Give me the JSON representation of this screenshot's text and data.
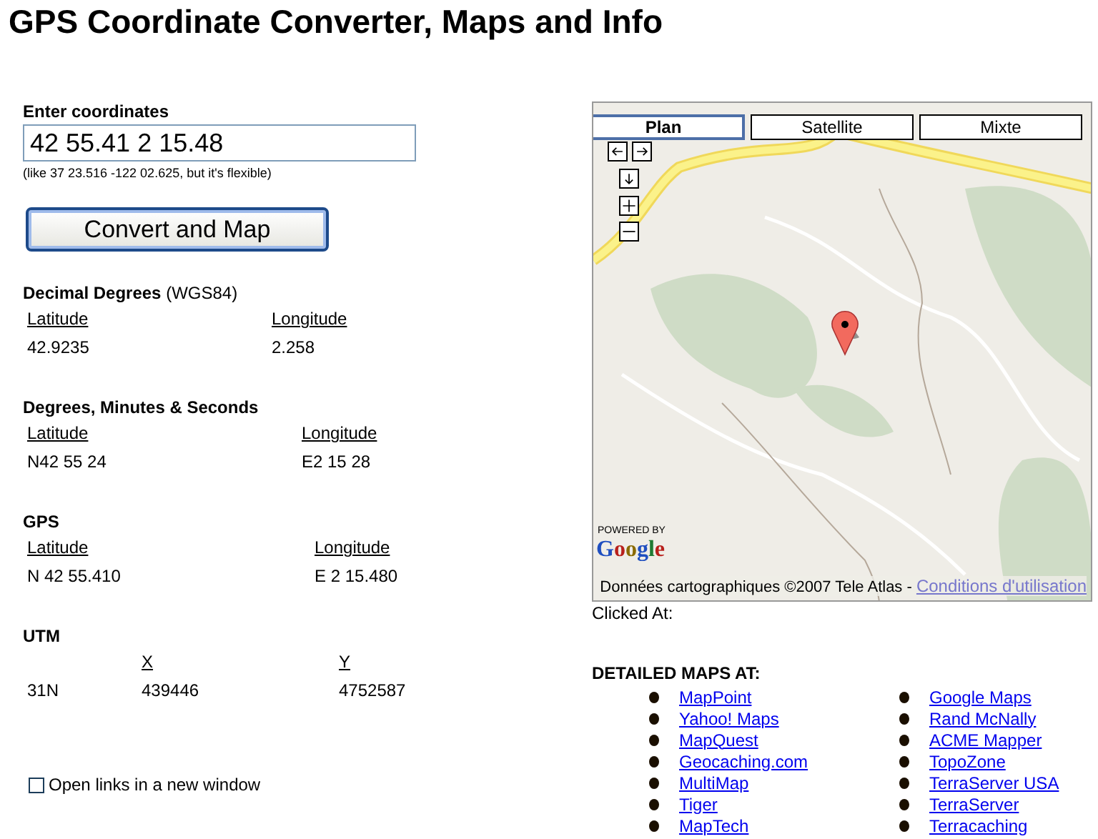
{
  "page_title": "GPS Coordinate Converter, Maps and Info",
  "input": {
    "label": "Enter coordinates",
    "value": "42 55.41 2 15.48",
    "hint": "(like 37 23.516 -122 02.625, but it's flexible)"
  },
  "convert_button": "Convert and Map",
  "sections": [
    {
      "title": "Decimal Degrees",
      "note": "(WGS84)",
      "columns": [
        {
          "header": "Latitude",
          "value": "42.9235"
        },
        {
          "header": "Longitude",
          "value": "2.258"
        }
      ]
    },
    {
      "title": "Degrees, Minutes & Seconds",
      "columns": [
        {
          "header": "Latitude",
          "value": "N42 55 24"
        },
        {
          "header": "Longitude",
          "value": "E2 15 28"
        }
      ]
    },
    {
      "title": "GPS",
      "columns": [
        {
          "header": "Latitude",
          "value": "N 42 55.410"
        },
        {
          "header": "Longitude",
          "value": "E 2 15.480"
        }
      ]
    },
    {
      "title": "UTM",
      "columns": [
        {
          "value": "31N"
        },
        {
          "header": "X",
          "value": "439446"
        },
        {
          "header": "Y",
          "value": "4752587"
        }
      ]
    }
  ],
  "new_window_option": {
    "label": "Open links in a new window",
    "checked": false
  },
  "map": {
    "tabs": [
      {
        "label": "Plan",
        "selected": true
      },
      {
        "label": "Satellite",
        "selected": false
      },
      {
        "label": "Mixte",
        "selected": false
      }
    ],
    "powered_by": "POWERED BY",
    "logo": "Google",
    "attribution": "Données cartographiques ©2007 Tele Atlas - ",
    "terms_link": "Conditions d'utilisation"
  },
  "clicked_at": "Clicked At:",
  "detailed_maps": {
    "title": "DETAILED MAPS AT:",
    "columns": [
      [
        "MapPoint",
        "Yahoo! Maps",
        "MapQuest",
        "Geocaching.com",
        "MultiMap",
        "Tiger",
        "MapTech"
      ],
      [
        "Google Maps",
        "Rand McNally",
        "ACME Mapper",
        "TopoZone",
        "TerraServer USA",
        "TerraServer",
        "Terracaching"
      ]
    ]
  }
}
